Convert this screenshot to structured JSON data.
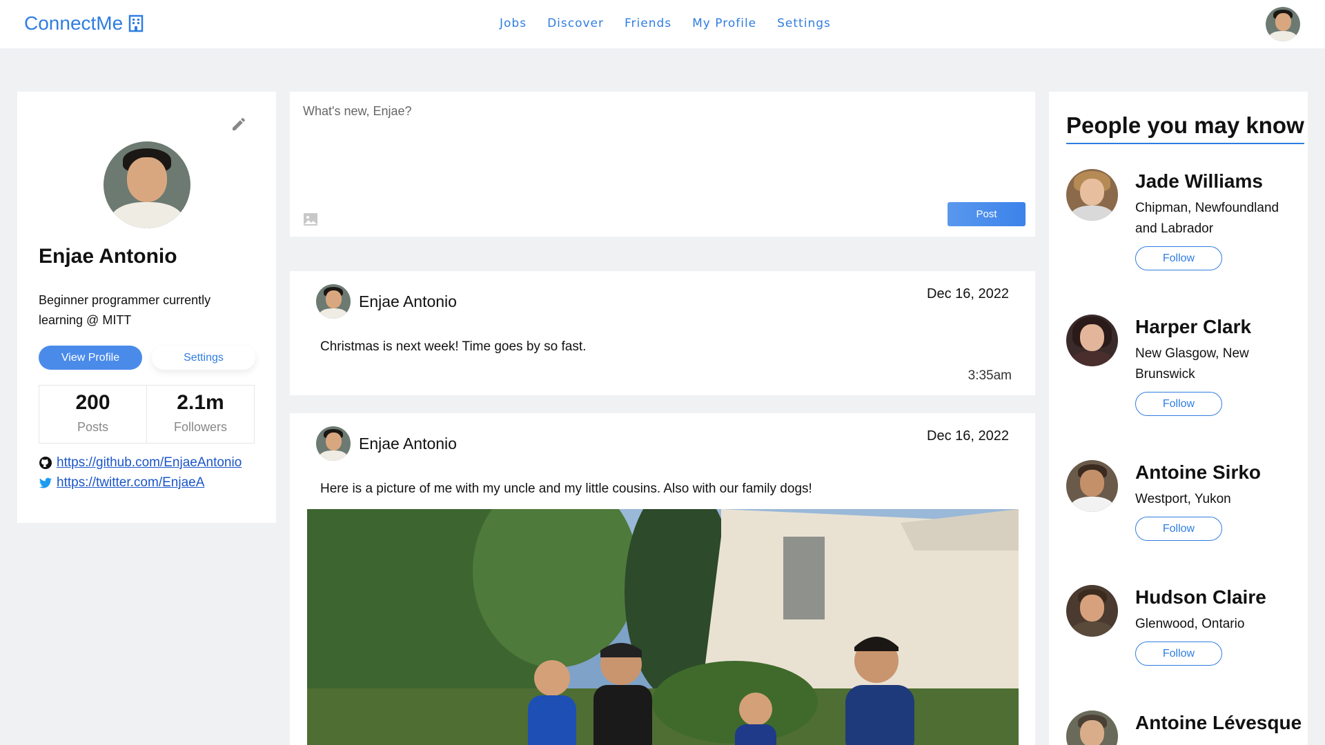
{
  "brand": {
    "name": "ConnectMe",
    "icon": "building-icon"
  },
  "nav": {
    "items": [
      "Jobs",
      "Discover",
      "Friends",
      "My Profile",
      "Settings"
    ]
  },
  "profile": {
    "name": "Enjae Antonio",
    "bio": "Beginner programmer currently learning @ MITT",
    "view_profile_label": "View Profile",
    "settings_label": "Settings",
    "stats": [
      {
        "value": "200",
        "label": "Posts"
      },
      {
        "value": "2.1m",
        "label": "Followers"
      }
    ],
    "links": [
      {
        "icon": "github-icon",
        "url": "https://github.com/EnjaeAntonio"
      },
      {
        "icon": "twitter-icon",
        "url": "https://twitter.com/EnjaeA"
      }
    ]
  },
  "composer": {
    "placeholder": "What's new, Enjae?",
    "post_label": "Post"
  },
  "posts": [
    {
      "author": "Enjae Antonio",
      "date": "Dec 16, 2022",
      "text": "Christmas is next week! Time goes by so fast.",
      "time": "3:35am"
    },
    {
      "author": "Enjae Antonio",
      "date": "Dec 16, 2022",
      "text": "Here is a picture of me with my uncle and my little cousins. Also with our family dogs!"
    }
  ],
  "people": {
    "title": "People you may know",
    "follow_label": "Follow",
    "list": [
      {
        "name": "Jade Williams",
        "location": "Chipman, Newfoundland and Labrador"
      },
      {
        "name": "Harper Clark",
        "location": "New Glasgow, New Brunswick"
      },
      {
        "name": "Antoine Sirko",
        "location": "Westport, Yukon"
      },
      {
        "name": "Hudson Claire",
        "location": "Glenwood, Ontario"
      },
      {
        "name": "Antoine Lévesque",
        "location": ""
      }
    ]
  },
  "colors": {
    "accent": "#2f7de1",
    "background": "#f0f1f3"
  }
}
